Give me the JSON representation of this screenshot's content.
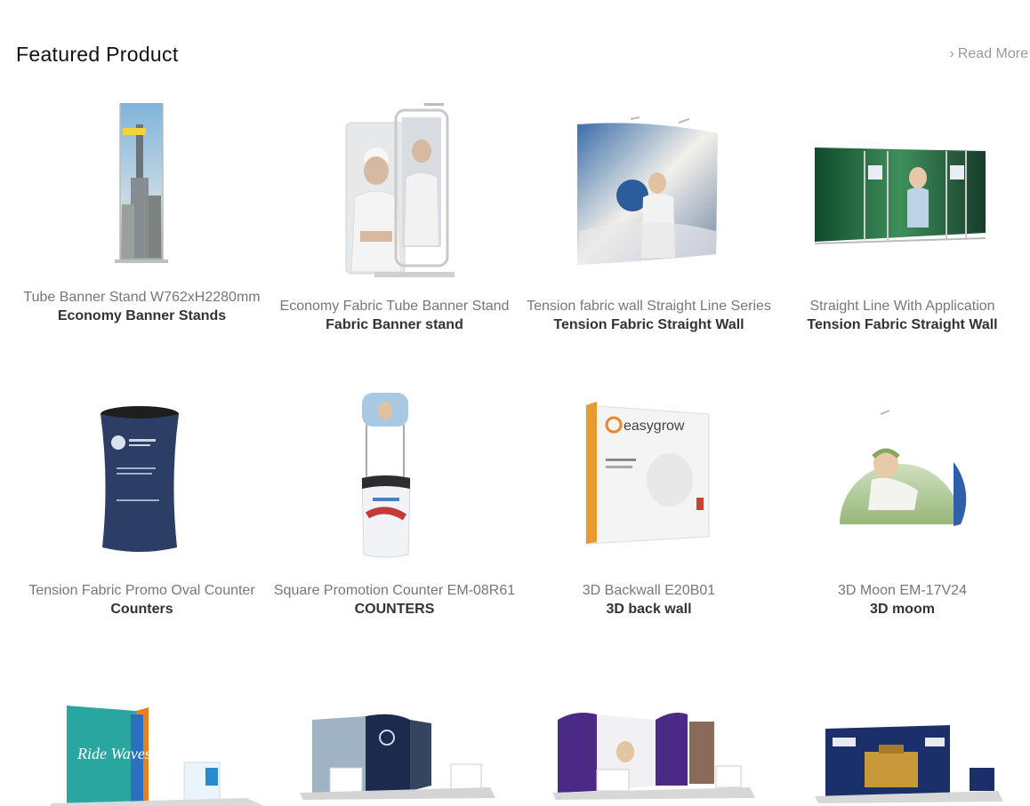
{
  "header": {
    "title": "Featured Product",
    "read_more": "Read More"
  },
  "products": [
    {
      "name": "Tube Banner Stand W762xH2280mm",
      "category": "Economy Banner Stands"
    },
    {
      "name": "Economy Fabric Tube Banner Stand",
      "category": "Fabric Banner stand"
    },
    {
      "name": "Tension fabric wall Straight Line Series",
      "category": "Tension Fabric Straight Wall"
    },
    {
      "name": "Straight Line With Application",
      "category": "Tension Fabric Straight Wall"
    },
    {
      "name": "Tension Fabric Promo Oval Counter",
      "category": "Counters"
    },
    {
      "name": "Square Promotion Counter EM-08R61",
      "category": "COUNTERS"
    },
    {
      "name": "3D Backwall E20B01",
      "category": "3D back wall"
    },
    {
      "name": "3D Moon EM-17V24",
      "category": "3D moom"
    }
  ],
  "thumb_text": {
    "easygrow": "easygrow",
    "ride_waves": "Ride Waves"
  }
}
